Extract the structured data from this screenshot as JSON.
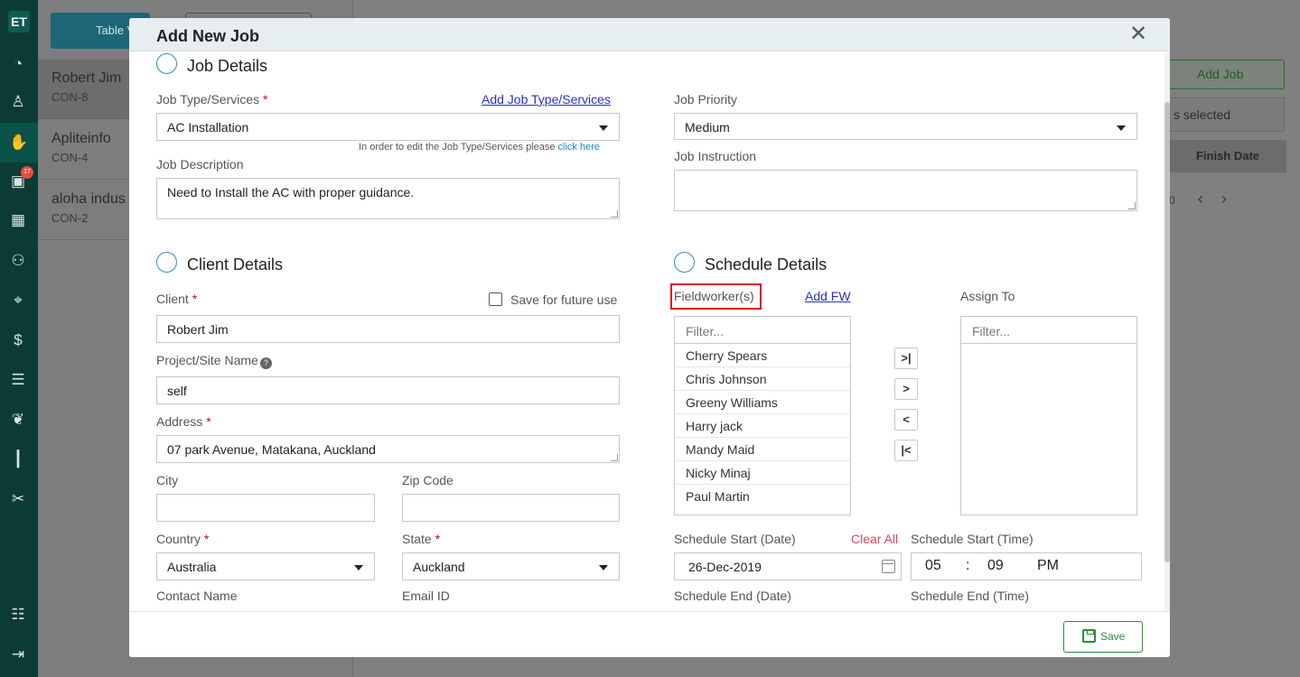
{
  "rail": {
    "logo": "ET",
    "badge_count": "17",
    "icons": [
      "dashboard-icon",
      "user-icon",
      "handshake-icon",
      "briefcase-icon",
      "calendar-icon",
      "users-icon",
      "map-pin-icon",
      "dollar-icon",
      "list-icon",
      "leaf-icon",
      "chart-icon",
      "tools-icon",
      "settings-icon",
      "logout-icon"
    ]
  },
  "background": {
    "table_view_label": "Table V",
    "rows": [
      {
        "name": "Robert Jim",
        "code": "CON-8"
      },
      {
        "name": "Apliteinfo",
        "code": "CON-4"
      },
      {
        "name": "aloha indus",
        "code": "CON-2"
      }
    ],
    "add_job_label": "Add Job",
    "selected_label": "s selected",
    "finish_date_label": "Finish Date",
    "pager_text": "0"
  },
  "modal": {
    "title": "Add New Job",
    "job_details": {
      "heading": "Job Details",
      "job_type_label": "Job Type/Services",
      "add_job_type_link": "Add Job Type/Services",
      "job_type_value": "AC Installation",
      "edit_note": "In order to edit the Job Type/Services please",
      "edit_note_link": "click here",
      "job_description_label": "Job Description",
      "job_description_value": "Need to Install the AC with proper guidance.",
      "job_priority_label": "Job Priority",
      "job_priority_value": "Medium",
      "job_instruction_label": "Job Instruction",
      "job_instruction_value": ""
    },
    "client_details": {
      "heading": "Client Details",
      "client_label": "Client",
      "save_future_label": "Save for future use",
      "client_value": "Robert Jim",
      "project_label": "Project/Site Name",
      "project_value": "self",
      "address_label": "Address",
      "address_value": "07 park Avenue, Matakana, Auckland",
      "city_label": "City",
      "city_value": "",
      "zip_label": "Zip Code",
      "zip_value": "",
      "country_label": "Country",
      "country_value": "Australia",
      "state_label": "State",
      "state_value": "Auckland",
      "contact_label": "Contact Name",
      "email_label": "Email ID"
    },
    "schedule_details": {
      "heading": "Schedule Details",
      "fieldworkers_label": "Fieldworker(s)",
      "add_fw_link": "Add FW",
      "assign_to_label": "Assign To",
      "filter_placeholder": "Filter...",
      "fieldworkers": [
        "Cherry Spears",
        "Chris Johnson",
        "Greeny Williams",
        "Harry jack",
        "Mandy Maid",
        "Nicky Minaj",
        "Paul Martin"
      ],
      "move_buttons": [
        ">|",
        ">",
        "<",
        "|<"
      ],
      "start_date_label": "Schedule Start (Date)",
      "clear_all": "Clear All",
      "start_date_value": "26-Dec-2019",
      "start_time_label": "Schedule Start (Time)",
      "start_hour": "05",
      "start_sep": ":",
      "start_min": "09",
      "start_ampm": "PM",
      "end_date_label": "Schedule End (Date)",
      "end_time_label": "Schedule End (Time)"
    },
    "save_label": "Save",
    "required_mark": "*",
    "help_mark": "?",
    "close_glyph": "✕"
  }
}
